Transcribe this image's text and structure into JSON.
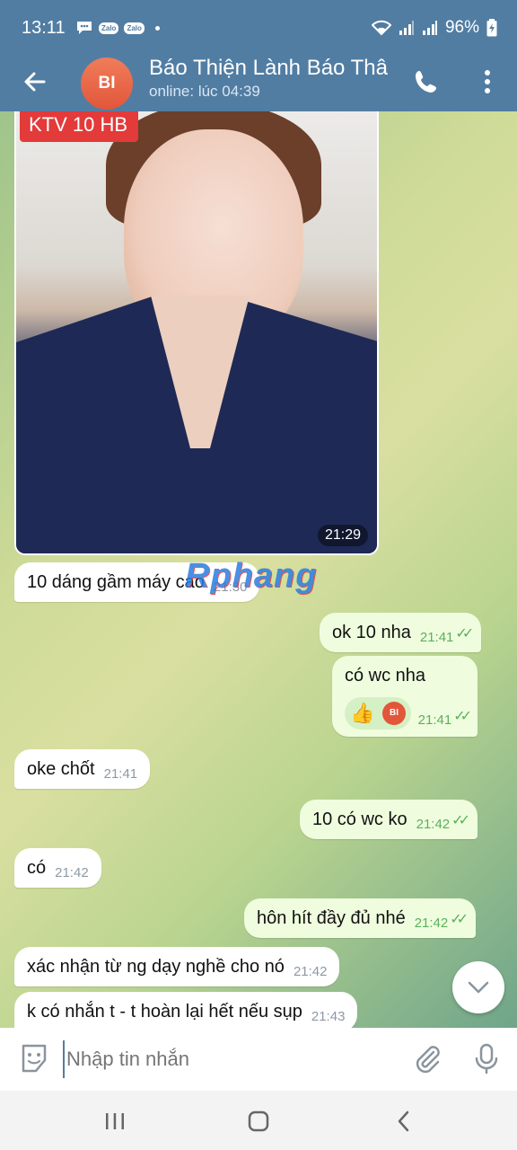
{
  "status_bar": {
    "time": "13:11",
    "notif_chip": "Zalo",
    "battery": "96%"
  },
  "header": {
    "avatar_initials": "BI",
    "title": "Báo Thiện Lành Báo Thâ",
    "subtitle": "online: lúc 04:39"
  },
  "photo": {
    "tag": "KTV 10 HB",
    "time": "21:29"
  },
  "watermark": "Rphang",
  "messages": [
    {
      "text": "10 dáng gầm máy cao",
      "time": "21:30"
    },
    {
      "text": "ok 10 nha",
      "time": "21:41"
    },
    {
      "text": "có wc nha",
      "time": "21:41",
      "reaction_badge": "BI"
    },
    {
      "text": "oke chốt",
      "time": "21:41"
    },
    {
      "text": "10 có wc ko",
      "time": "21:42"
    },
    {
      "text": "có",
      "time": "21:42"
    },
    {
      "text": "hôn hít đầy đủ nhé",
      "time": "21:42"
    },
    {
      "text": "xác nhận từ ng dạy nghề cho nó",
      "time": "21:42"
    },
    {
      "text": "k có nhắn t - t hoàn lại hết nếu sụp",
      "time": "21:43"
    }
  ],
  "composer": {
    "placeholder": "Nhập tin nhắn"
  },
  "icons": [
    "message-icon",
    "wifi-icon",
    "signal-icon",
    "battery-icon",
    "back-arrow-icon",
    "phone-icon",
    "more-vert-icon",
    "thumbs-up-icon",
    "chevron-down-icon",
    "sticker-icon",
    "attach-icon",
    "mic-icon",
    "recents-icon",
    "home-icon",
    "back-nav-icon"
  ],
  "colors": {
    "header": "#527da3",
    "outgoing_bubble": "#effdde",
    "incoming_bubble": "#ffffff",
    "check": "#5bb05c"
  }
}
